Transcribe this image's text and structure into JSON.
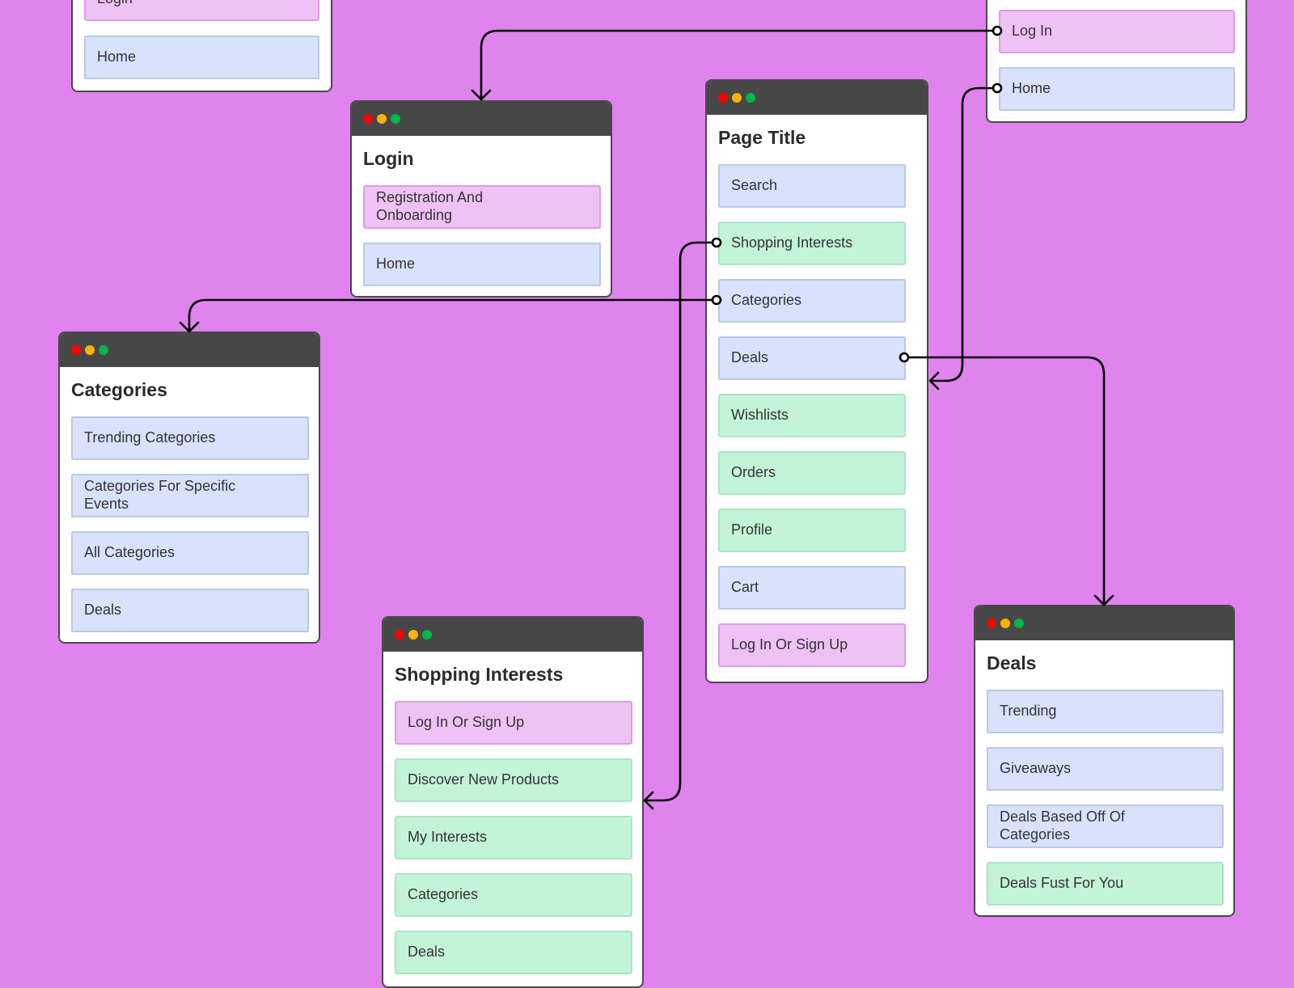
{
  "colors": {
    "background": "#e083ee",
    "titlebar": "#474747",
    "item_blue": "#d8e2fd",
    "item_green": "#c3f4d8",
    "item_pink": "#efc2f5",
    "connector": "#000000"
  },
  "cards": [
    {
      "id": "login-top-left",
      "title": "",
      "items": [
        {
          "label": "Login",
          "style": "pink"
        },
        {
          "label": "Home",
          "style": "blue"
        }
      ]
    },
    {
      "id": "login-top-right",
      "title": "",
      "items": [
        {
          "label": "Log In",
          "style": "pink"
        },
        {
          "label": "Home",
          "style": "blue"
        }
      ]
    },
    {
      "id": "login",
      "title": "Login",
      "items": [
        {
          "label": "Registration And\n Onboarding",
          "style": "pink"
        },
        {
          "label": "Home",
          "style": "blue"
        }
      ]
    },
    {
      "id": "page-title",
      "title": "Page Title",
      "items": [
        {
          "label": "Search",
          "style": "blue"
        },
        {
          "label": "Shopping Interests",
          "style": "green"
        },
        {
          "label": "Categories",
          "style": "blue"
        },
        {
          "label": "Deals",
          "style": "blue"
        },
        {
          "label": "Wishlists",
          "style": "green"
        },
        {
          "label": "Orders",
          "style": "green"
        },
        {
          "label": "Profile",
          "style": "green"
        },
        {
          "label": "Cart",
          "style": "blue"
        },
        {
          "label": "Log In Or Sign Up",
          "style": "pink"
        }
      ]
    },
    {
      "id": "categories",
      "title": "Categories",
      "items": [
        {
          "label": "Trending Categories",
          "style": "blue"
        },
        {
          "label": "Categories For Specific\nEvents",
          "style": "blue"
        },
        {
          "label": "All Categories",
          "style": "blue"
        },
        {
          "label": "Deals",
          "style": "blue"
        }
      ]
    },
    {
      "id": "shopping-interests",
      "title": "Shopping Interests",
      "items": [
        {
          "label": "Log In Or Sign Up",
          "style": "pink"
        },
        {
          "label": "Discover New Products",
          "style": "green"
        },
        {
          "label": "My Interests",
          "style": "green"
        },
        {
          "label": "Categories",
          "style": "green"
        },
        {
          "label": "Deals",
          "style": "green"
        }
      ]
    },
    {
      "id": "deals",
      "title": "Deals",
      "items": [
        {
          "label": "Trending",
          "style": "blue"
        },
        {
          "label": "Giveaways",
          "style": "blue"
        },
        {
          "label": "Deals Based Off Of\nCategories",
          "style": "blue"
        },
        {
          "label": "Deals Fust For You",
          "style": "green"
        }
      ]
    }
  ],
  "connections": [
    {
      "from": "login-top-right: Log In",
      "to": "Login"
    },
    {
      "from": "login-top-right: Home",
      "to": "Page Title"
    },
    {
      "from": "Page Title: Shopping Interests",
      "to": "Shopping Interests"
    },
    {
      "from": "Page Title: Categories",
      "to": "Categories"
    },
    {
      "from": "Page Title: Deals",
      "to": "Deals"
    }
  ]
}
